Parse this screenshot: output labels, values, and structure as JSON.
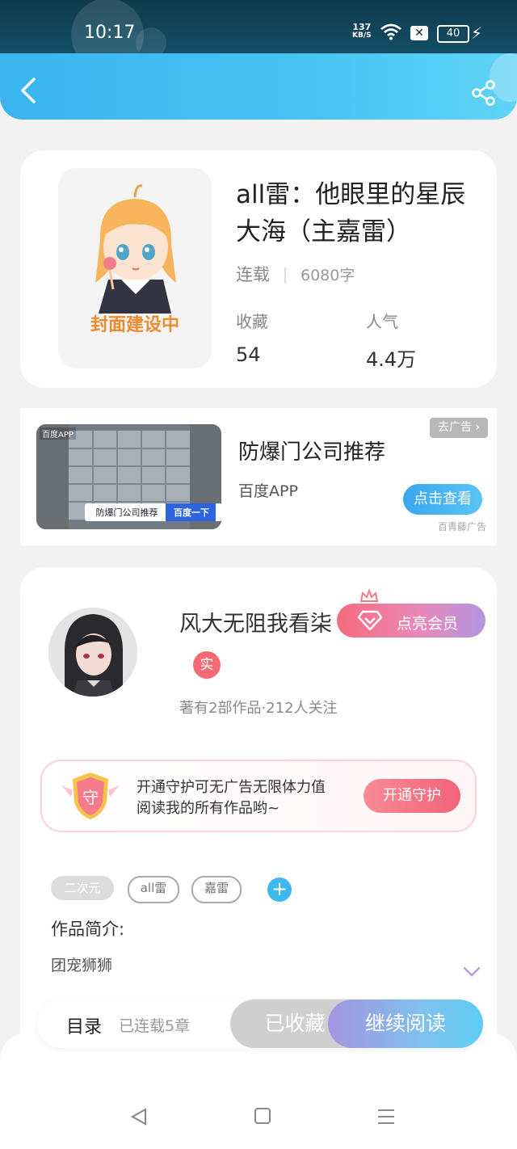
{
  "status_bar": {
    "time": "10:17",
    "speed_top": "137",
    "speed_unit": "KB/S",
    "battery": "40"
  },
  "book": {
    "cover_caption": "封面建设中",
    "title": "all雷：他眼里的星辰大海（主嘉雷）",
    "status": "连载",
    "word_count": "6080字",
    "stats": [
      {
        "label": "收藏",
        "value": "54"
      },
      {
        "label": "人气",
        "value": "4.4万"
      }
    ]
  },
  "ad": {
    "badge": "百度APP",
    "image_caption": "防爆门公司推荐",
    "image_button": "百度一下",
    "title": "防爆门公司推荐",
    "subtitle": "百度APP",
    "close_label": "去广告",
    "cta": "点击查看",
    "source": "百青藤广告"
  },
  "author": {
    "name": "风大无阻我看柒",
    "vip_label": "点亮会员",
    "real_badge": "实",
    "meta": "著有2部作品·212人关注",
    "guard": {
      "shield_char": "守",
      "text_line1": "开通守护可无广告无限体力值",
      "text_line2": "阅读我的所有作品哟~",
      "button": "开通守护"
    },
    "tags": [
      "二次元",
      "all雷",
      "嘉雷"
    ],
    "intro_label": "作品简介:",
    "intro_text": "团宠狮狮"
  },
  "bottom_bar": {
    "toc": "目录",
    "chapters": "已连载5章",
    "collected": "已收藏",
    "continue": "继续阅读"
  },
  "colors": {
    "accent": "#3ab4ef",
    "vip_pink": "#f86a7d",
    "guard_pink": "#f4637a"
  }
}
